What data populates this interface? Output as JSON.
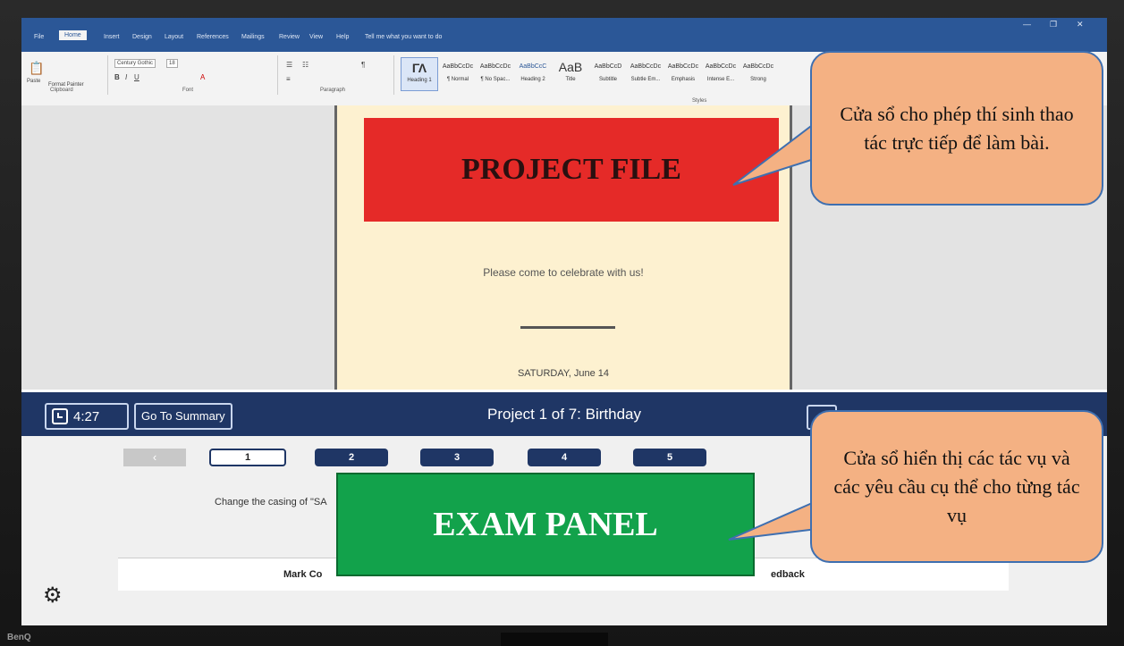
{
  "word": {
    "title": "",
    "tabs": [
      "File",
      "Home",
      "Insert",
      "Design",
      "Layout",
      "References",
      "Mailings",
      "Review",
      "View",
      "Help"
    ],
    "tell_me": "Tell me what you want to do",
    "groups": {
      "clipboard": "Clipboard",
      "font": "Font",
      "paragraph": "Paragraph",
      "styles": "Styles"
    },
    "font_name": "Century Gothic",
    "font_size": "18",
    "paste_label": "Paste",
    "format_painter": "Format Painter",
    "styles": [
      {
        "preview": "AaBbCcDc",
        "name": "Heading 1"
      },
      {
        "preview": "AaBbCcDc",
        "name": "¶ Normal"
      },
      {
        "preview": "AaBbCcDc",
        "name": "¶ No Spac..."
      },
      {
        "preview": "AaBbCcC",
        "name": "Heading 2"
      },
      {
        "preview": "AaB",
        "name": "Title"
      },
      {
        "preview": "AaBbCcD",
        "name": "Subtitle"
      },
      {
        "preview": "AaBbCcDc",
        "name": "Subtle Em..."
      },
      {
        "preview": "AaBbCcDc",
        "name": "Emphasis"
      },
      {
        "preview": "AaBbCcDc",
        "name": "Intense E..."
      },
      {
        "preview": "AaBbCcDc",
        "name": "Strong"
      }
    ]
  },
  "document": {
    "banner": "PROJECT FILE",
    "celebrate": "Please come to celebrate with us!",
    "date": "SATURDAY, June 14"
  },
  "exam": {
    "timer": "4:27",
    "summary_button": "Go To Summary",
    "project_title": "Project 1 of 7: Birthday",
    "back_arrow": "‹",
    "tasks": [
      "1",
      "2",
      "3",
      "4",
      "5"
    ],
    "active_task": "1",
    "task_text": "Change the casing of \"SA",
    "mark_complete": "Mark Co",
    "feedback": "edback",
    "panel_label": "EXAM PANEL"
  },
  "callouts": {
    "top": "Cửa sổ cho phép thí sinh thao tác trực tiếp để làm bài.",
    "bottom": "Cửa sổ hiển thị các tác vụ và các yêu cầu cụ thể cho từng tác vụ"
  },
  "monitor_brand": "BenQ",
  "colors": {
    "word_blue": "#2b5797",
    "exam_navy": "#1f3665",
    "banner_red": "#e52a28",
    "panel_green": "#12a24b",
    "callout_fill": "#f4b183",
    "callout_border": "#3e6fb0"
  }
}
